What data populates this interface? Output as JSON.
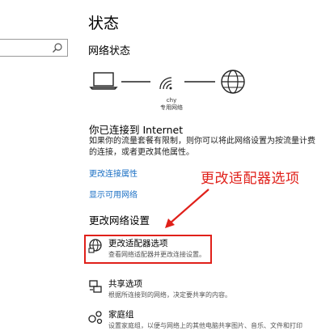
{
  "header": {
    "title": "状态"
  },
  "network_status": {
    "heading": "网络状态",
    "ssid": "chy",
    "network_type": "专用网络"
  },
  "connection": {
    "heading": "你已连接到 Internet",
    "description": "如果你的流量套餐有限制，则你可以将此网络设置为按流量计费的连接，或者更改其他属性。",
    "links": [
      "更改连接属性",
      "显示可用网络"
    ]
  },
  "annotation": {
    "text": "更改适配器选项",
    "color": "#e0201a"
  },
  "change_settings": {
    "heading": "更改网络设置",
    "options": [
      {
        "icon": "adapter-icon",
        "title": "更改适配器选项",
        "desc": "查看网络适配器并更改连接设置。"
      },
      {
        "icon": "sharing-icon",
        "title": "共享选项",
        "desc": "根据所连接到的网络，决定要共享的内容。"
      },
      {
        "icon": "homegroup-icon",
        "title": "家庭组",
        "desc": "设置家庭组，以便与网络上的其他电脑共享图片、音乐、文件和打印"
      }
    ]
  },
  "colors": {
    "link": "#1a6fc4",
    "highlight": "#e0201a"
  }
}
